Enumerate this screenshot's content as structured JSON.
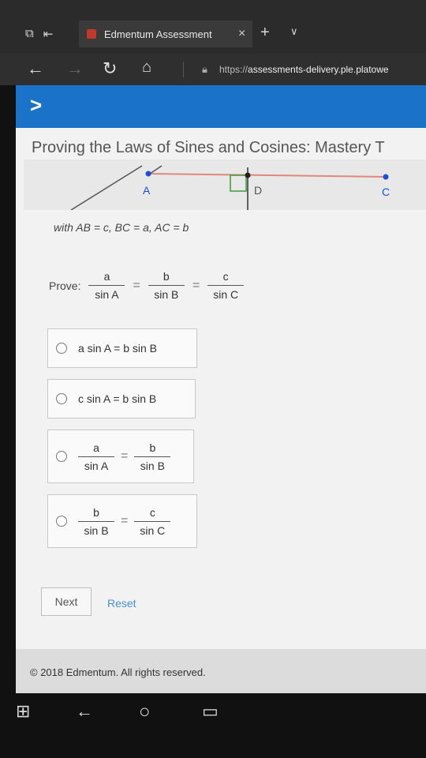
{
  "browser": {
    "tab_title": "Edmentum Assessment",
    "tab_close": "×",
    "new_tab": "+",
    "tab_menu": "∨",
    "url_scheme": "https://",
    "url_host": "assessments-delivery.ple.platowe"
  },
  "page": {
    "title": "Proving the Laws of Sines and Cosines: Mastery T",
    "diagram": {
      "labels": [
        "A",
        "D",
        "C"
      ]
    },
    "given": "with AB = c, BC = a, AC = b",
    "prove_label": "Prove:",
    "prove_fracs": [
      {
        "num": "a",
        "den": "sin A"
      },
      {
        "num": "b",
        "den": "sin B"
      },
      {
        "num": "c",
        "den": "sin C"
      }
    ],
    "equals": "=",
    "options": [
      {
        "text": "a sin A = b sin B"
      },
      {
        "text": "c sin A = b sin B"
      },
      {
        "left": {
          "num": "a",
          "den": "sin A"
        },
        "right": {
          "num": "b",
          "den": "sin B"
        }
      },
      {
        "left": {
          "num": "b",
          "den": "sin B"
        },
        "right": {
          "num": "c",
          "den": "sin C"
        }
      }
    ],
    "next_label": "Next",
    "reset_label": "Reset",
    "copyright": "© 2018 Edmentum. All rights reserved."
  },
  "colors": {
    "header_blue": "#1a73c9",
    "point_blue": "#1a4fd6",
    "line_red": "#e0877a"
  }
}
